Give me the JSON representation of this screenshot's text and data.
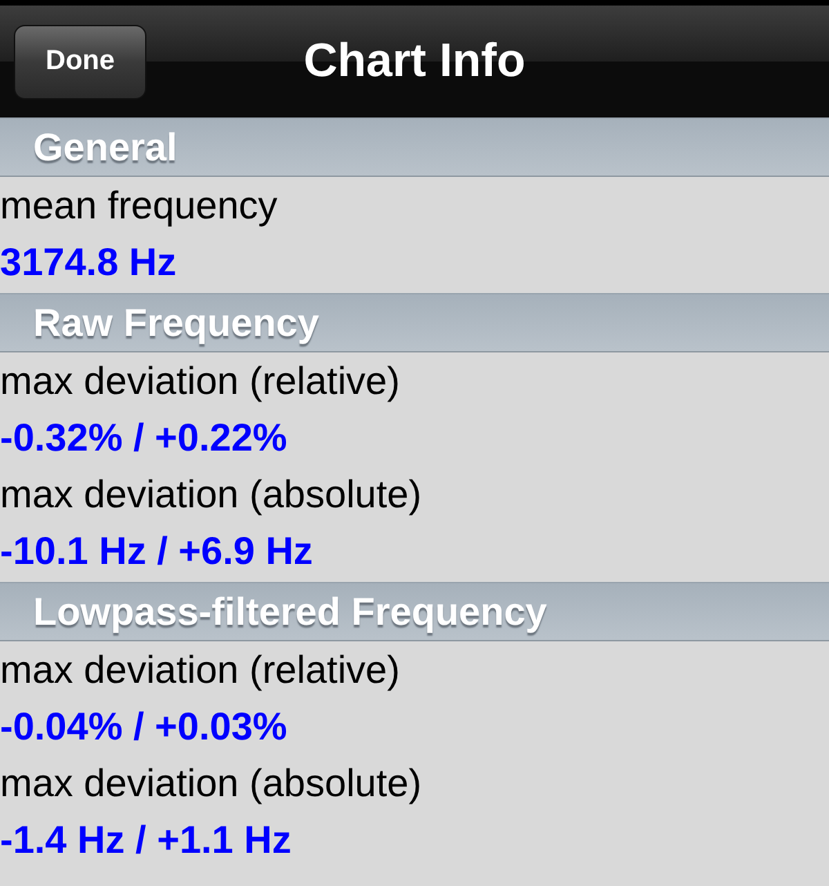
{
  "nav_bar": {
    "title": "Chart Info",
    "button": "Done"
  },
  "sections": [
    {
      "title": "General",
      "items": [
        {
          "label": "mean frequency",
          "value": "3174.8 Hz"
        }
      ]
    },
    {
      "title": "Raw Frequency",
      "items": [
        {
          "label": "max deviation (relative)",
          "value": "-0.32% / +0.22%"
        },
        {
          "label": "max deviation (absolute)",
          "value": "-10.1 Hz / +6.9 Hz"
        }
      ]
    },
    {
      "title": "Lowpass-filtered Frequency",
      "items": [
        {
          "label": "max deviation (relative)",
          "value": "-0.04% / +0.03%"
        },
        {
          "label": "max deviation (absolute)",
          "value": "-1.4 Hz / +1.1 Hz"
        }
      ]
    }
  ]
}
